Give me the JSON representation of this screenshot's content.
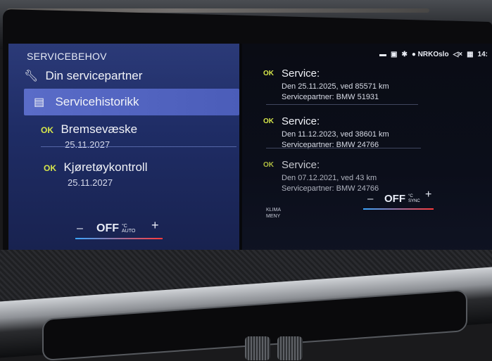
{
  "left": {
    "section_title": "SERVICEBEHOV",
    "partner_label": "Din servicepartner",
    "history_label": "Servicehistorikk",
    "items": [
      {
        "status": "OK",
        "label": "Bremsevæske",
        "date": "25.11.2027"
      },
      {
        "status": "OK",
        "label": "Kjøretøykontroll",
        "date": "25.11.2027"
      }
    ],
    "climate": {
      "minus": "–",
      "state": "OFF",
      "mode_unit": "°C",
      "mode": "AUTO",
      "plus": "+"
    }
  },
  "right": {
    "status_bar": {
      "station": "NRKOslo",
      "time": "14:"
    },
    "entries": [
      {
        "status": "OK",
        "title": "Service:",
        "date_line": "Den 25.11.2025, ved 85571 km",
        "partner_line": "Servicepartner: BMW 51931"
      },
      {
        "status": "OK",
        "title": "Service:",
        "date_line": "Den 11.12.2023, ved 38601 km",
        "partner_line": "Servicepartner: BMW 24766"
      },
      {
        "status": "OK",
        "title": "Service:",
        "date_line": "Den 07.12.2021, ved 43 km",
        "partner_line": "Servicepartner: BMW 24766"
      }
    ],
    "footer": {
      "line1": "KLIMA",
      "line2": "MENY"
    },
    "climate": {
      "minus": "–",
      "state": "OFF",
      "mode_unit": "°C",
      "mode": "SYNC",
      "plus": "+"
    }
  },
  "icons": {
    "partner": "wrench-icon",
    "history": "service-book-icon"
  },
  "colors": {
    "ok": "#d6e64a",
    "highlight": "#5a6cc8",
    "left_panel": "#2b3a78"
  }
}
